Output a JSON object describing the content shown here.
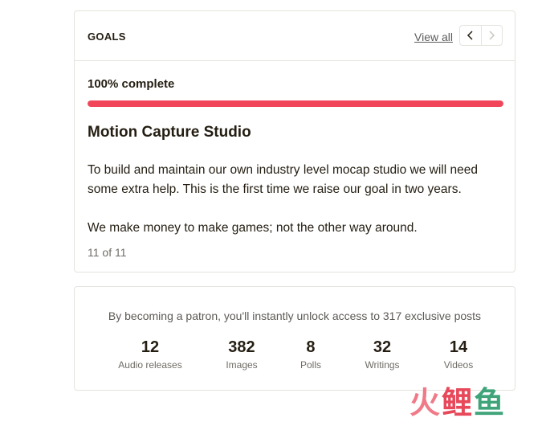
{
  "goals": {
    "header_title": "GOALS",
    "view_all": "View all",
    "progress_label": "100% complete",
    "progress_fraction": 1.0,
    "progress_color": "#f1465a",
    "title": "Motion Capture Studio",
    "description_1": "To build and maintain our own industry level mocap studio we will need some extra help. This is the first time we raise our goal in two years.",
    "description_2": "We make money to make games; not the other way around.",
    "count": "11 of 11",
    "prev_icon": "chevron-left-icon",
    "next_icon": "chevron-right-icon"
  },
  "stats": {
    "intro": "By becoming a patron, you'll instantly unlock access to 317 exclusive posts",
    "items": [
      {
        "value": "12",
        "label": "Audio releases"
      },
      {
        "value": "382",
        "label": "Images"
      },
      {
        "value": "8",
        "label": "Polls"
      },
      {
        "value": "32",
        "label": "Writings"
      },
      {
        "value": "14",
        "label": "Videos"
      }
    ]
  },
  "watermark": {
    "char1": "火",
    "char2": "鲤",
    "char3": "鱼"
  }
}
